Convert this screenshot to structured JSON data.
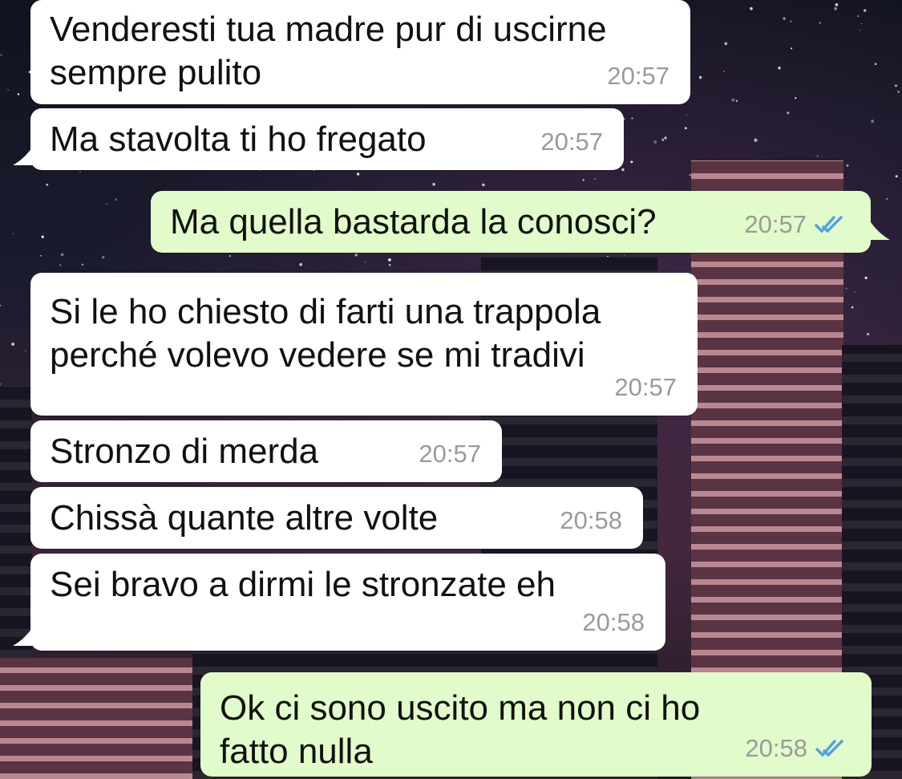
{
  "conversation": {
    "messages": [
      {
        "direction": "in",
        "text": "Venderesti tua madre pur di uscirne\nsempre pulito",
        "time": "20:57"
      },
      {
        "direction": "in",
        "text": "Ma stavolta ti ho fregato",
        "time": "20:57"
      },
      {
        "direction": "out",
        "text": "Ma quella bastarda la conosci?",
        "time": "20:57",
        "status": "double-check-read-icon"
      },
      {
        "direction": "in",
        "text": "Si le ho chiesto di farti una trappola\nperché volevo vedere se mi tradivi",
        "time": "20:57"
      },
      {
        "direction": "in",
        "text": "Stronzo di merda",
        "time": "20:57"
      },
      {
        "direction": "in",
        "text": "Chissà quante altre volte",
        "time": "20:58"
      },
      {
        "direction": "in",
        "text": "Sei bravo a dirmi le stronzate eh",
        "time": "20:58"
      },
      {
        "direction": "out",
        "text": "Ok ci sono uscito ma non ci ho\nfatto nulla",
        "time": "20:58",
        "status": "double-check-read-icon"
      }
    ]
  },
  "colors": {
    "incoming_bubble": "#ffffff",
    "outgoing_bubble": "#e2fbca",
    "read_check": "#4fa3e0",
    "timestamp": "#9a9a9a"
  }
}
